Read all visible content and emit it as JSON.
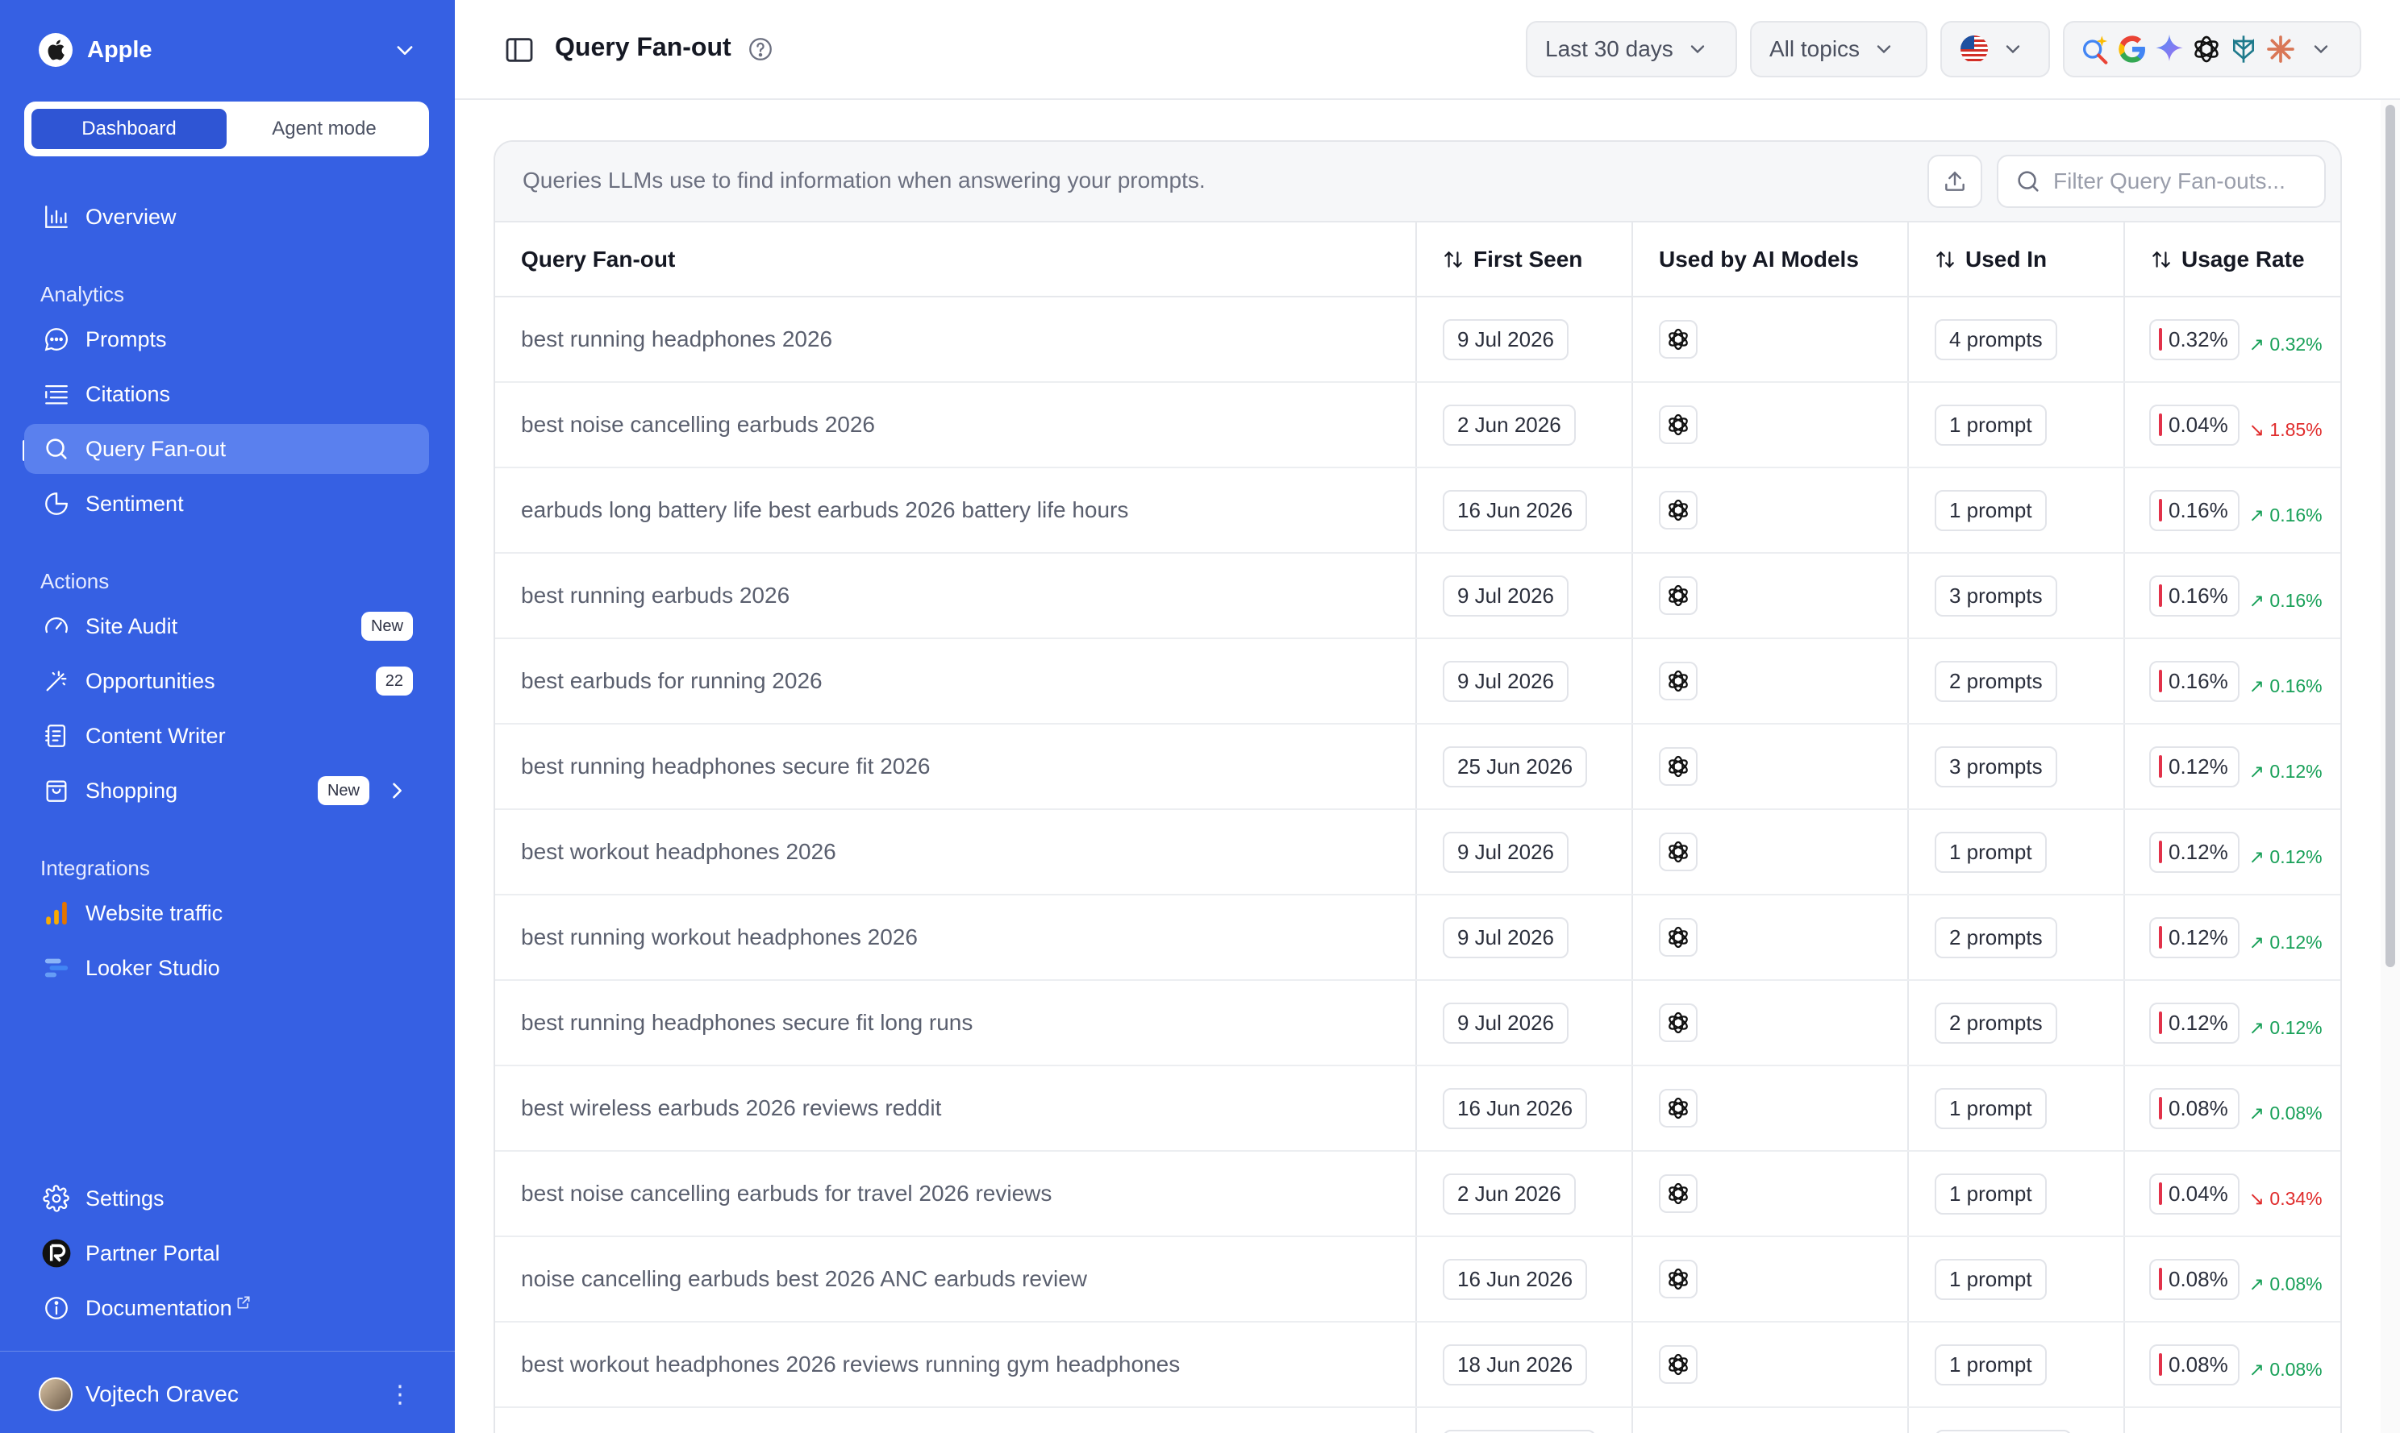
{
  "sidebar": {
    "brand": "Apple",
    "modes": [
      "Dashboard",
      "Agent mode"
    ],
    "nav_top": [
      {
        "label": "Overview",
        "icon": "bar-chart-icon"
      }
    ],
    "sections": {
      "analytics": "Analytics",
      "actions": "Actions",
      "integrations": "Integrations"
    },
    "analytics": [
      {
        "label": "Prompts",
        "icon": "chat-bubble-icon"
      },
      {
        "label": "Citations",
        "icon": "list-icon"
      },
      {
        "label": "Query Fan-out",
        "icon": "search-icon"
      },
      {
        "label": "Sentiment",
        "icon": "pie-chart-icon"
      }
    ],
    "actions": [
      {
        "label": "Site Audit",
        "icon": "gauge-icon",
        "badge": "New"
      },
      {
        "label": "Opportunities",
        "icon": "magic-wand-icon",
        "badge": "22"
      },
      {
        "label": "Content Writer",
        "icon": "document-icon"
      },
      {
        "label": "Shopping",
        "icon": "shopping-bag-icon",
        "badge": "New"
      }
    ],
    "integrations": [
      {
        "label": "Website traffic",
        "icon": "analytics-bars-icon"
      },
      {
        "label": "Looker Studio",
        "icon": "looker-icon"
      }
    ],
    "bottom": [
      {
        "label": "Settings",
        "icon": "gear-icon"
      },
      {
        "label": "Partner Portal",
        "icon": "partner-logo-icon"
      },
      {
        "label": "Documentation",
        "icon": "info-icon"
      }
    ],
    "user": "Vojtech Oravec"
  },
  "header": {
    "title": "Query Fan-out",
    "date_range": "Last 30 days",
    "topics": "All topics",
    "country_flag": "us-flag-icon",
    "model_icons": [
      "ai-overview-icon",
      "google-icon",
      "gemini-icon",
      "chatgpt-icon",
      "perplexity-icon",
      "claude-icon"
    ]
  },
  "card": {
    "description": "Queries LLMs use to find information when answering your prompts.",
    "search_placeholder": "Filter Query Fan-outs..."
  },
  "table": {
    "columns": [
      "Query Fan-out",
      "First Seen",
      "Used by AI Models",
      "Used In",
      "Usage Rate"
    ],
    "rows": [
      {
        "query": "best running headphones 2026",
        "first_seen": "9 Jul 2026",
        "model": "chatgpt-icon",
        "used_in": "4 prompts",
        "rate": "0.32%",
        "delta": "0.32%",
        "trend": "up"
      },
      {
        "query": "best noise cancelling earbuds 2026",
        "first_seen": "2 Jun 2026",
        "model": "chatgpt-icon",
        "used_in": "1 prompt",
        "rate": "0.04%",
        "delta": "1.85%",
        "trend": "down"
      },
      {
        "query": "earbuds long battery life best earbuds 2026 battery life hours",
        "first_seen": "16 Jun 2026",
        "model": "chatgpt-icon",
        "used_in": "1 prompt",
        "rate": "0.16%",
        "delta": "0.16%",
        "trend": "up"
      },
      {
        "query": "best running earbuds 2026",
        "first_seen": "9 Jul 2026",
        "model": "chatgpt-icon",
        "used_in": "3 prompts",
        "rate": "0.16%",
        "delta": "0.16%",
        "trend": "up"
      },
      {
        "query": "best earbuds for running 2026",
        "first_seen": "9 Jul 2026",
        "model": "chatgpt-icon",
        "used_in": "2 prompts",
        "rate": "0.16%",
        "delta": "0.16%",
        "trend": "up"
      },
      {
        "query": "best running headphones secure fit 2026",
        "first_seen": "25 Jun 2026",
        "model": "chatgpt-icon",
        "used_in": "3 prompts",
        "rate": "0.12%",
        "delta": "0.12%",
        "trend": "up"
      },
      {
        "query": "best workout headphones 2026",
        "first_seen": "9 Jul 2026",
        "model": "chatgpt-icon",
        "used_in": "1 prompt",
        "rate": "0.12%",
        "delta": "0.12%",
        "trend": "up"
      },
      {
        "query": "best running workout headphones 2026",
        "first_seen": "9 Jul 2026",
        "model": "chatgpt-icon",
        "used_in": "2 prompts",
        "rate": "0.12%",
        "delta": "0.12%",
        "trend": "up"
      },
      {
        "query": "best running headphones secure fit long runs",
        "first_seen": "9 Jul 2026",
        "model": "chatgpt-icon",
        "used_in": "2 prompts",
        "rate": "0.12%",
        "delta": "0.12%",
        "trend": "up"
      },
      {
        "query": "best wireless earbuds 2026 reviews reddit",
        "first_seen": "16 Jun 2026",
        "model": "chatgpt-icon",
        "used_in": "1 prompt",
        "rate": "0.08%",
        "delta": "0.08%",
        "trend": "up"
      },
      {
        "query": "best noise cancelling earbuds for travel 2026 reviews",
        "first_seen": "2 Jun 2026",
        "model": "chatgpt-icon",
        "used_in": "1 prompt",
        "rate": "0.04%",
        "delta": "0.34%",
        "trend": "down"
      },
      {
        "query": "noise cancelling earbuds best 2026 ANC earbuds review",
        "first_seen": "16 Jun 2026",
        "model": "chatgpt-icon",
        "used_in": "1 prompt",
        "rate": "0.08%",
        "delta": "0.08%",
        "trend": "up"
      },
      {
        "query": "best workout headphones 2026 reviews running gym headphones",
        "first_seen": "18 Jun 2026",
        "model": "chatgpt-icon",
        "used_in": "1 prompt",
        "rate": "0.08%",
        "delta": "0.08%",
        "trend": "up"
      },
      {
        "query": "",
        "first_seen": "",
        "model": "",
        "used_in": "",
        "rate": "",
        "delta": "",
        "trend": ""
      }
    ]
  },
  "colors": {
    "sidebar": "#3660e3",
    "active_item": "#5a80ee",
    "up": "#18a058",
    "down": "#e02c2c",
    "rate_bar": "#e2324a"
  }
}
